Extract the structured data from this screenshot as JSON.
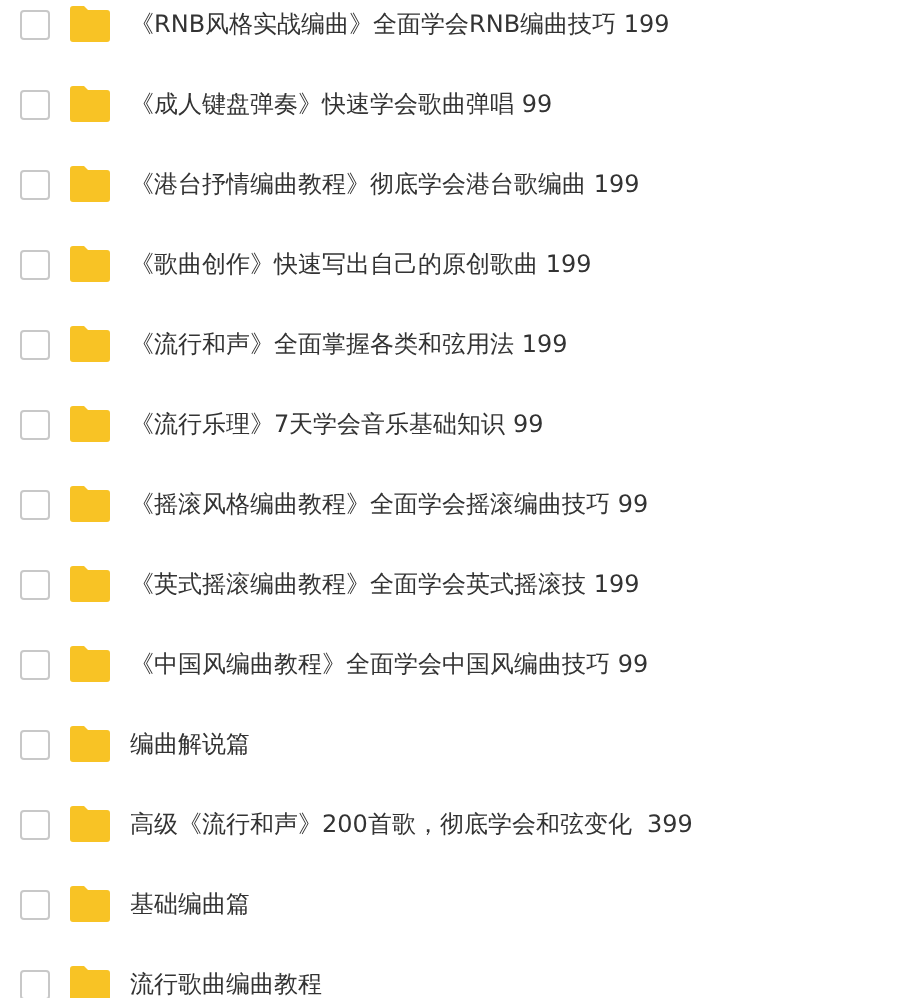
{
  "files": [
    {
      "name": "《RNB风格实战编曲》全面学会RNB编曲技巧 199",
      "checked": false
    },
    {
      "name": "《成人键盘弹奏》快速学会歌曲弹唱 99",
      "checked": false
    },
    {
      "name": "《港台抒情编曲教程》彻底学会港台歌编曲 199",
      "checked": false
    },
    {
      "name": "《歌曲创作》快速写出自己的原创歌曲 199",
      "checked": false
    },
    {
      "name": "《流行和声》全面掌握各类和弦用法 199",
      "checked": false
    },
    {
      "name": "《流行乐理》7天学会音乐基础知识 99",
      "checked": false
    },
    {
      "name": "《摇滚风格编曲教程》全面学会摇滚编曲技巧 99",
      "checked": false
    },
    {
      "name": "《英式摇滚编曲教程》全面学会英式摇滚技 199",
      "checked": false
    },
    {
      "name": "《中国风编曲教程》全面学会中国风编曲技巧 99",
      "checked": false
    },
    {
      "name": "编曲解说篇",
      "checked": false
    },
    {
      "name": "高级《流行和声》200首歌，彻底学会和弦变化  399",
      "checked": false
    },
    {
      "name": "基础编曲篇",
      "checked": false
    },
    {
      "name": "流行歌曲编曲教程",
      "checked": false
    }
  ]
}
